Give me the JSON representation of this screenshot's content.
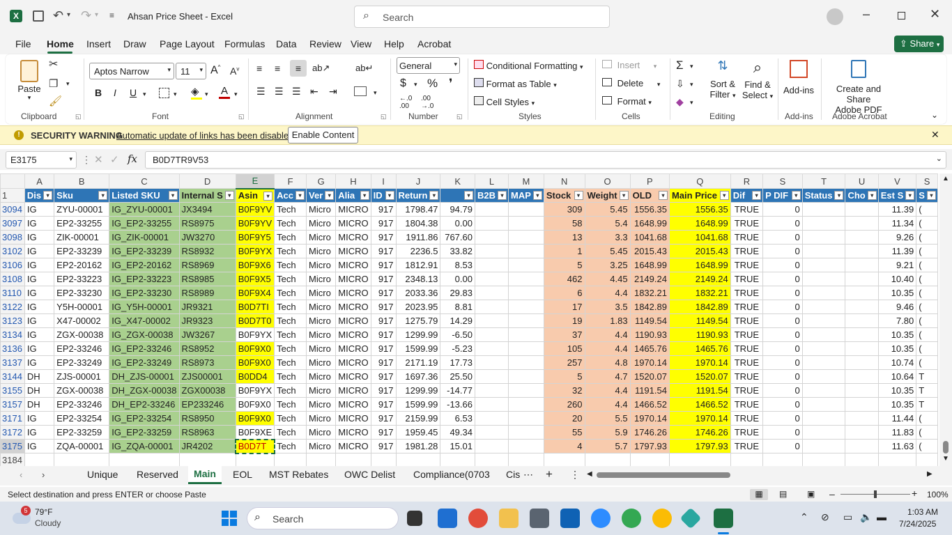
{
  "app": {
    "title": "Ahsan Price Sheet",
    "app_name": "Excel",
    "search_placeholder": "Search"
  },
  "ribbon_tabs": [
    "File",
    "Home",
    "Insert",
    "Draw",
    "Page Layout",
    "Formulas",
    "Data",
    "Review",
    "View",
    "Help",
    "Acrobat"
  ],
  "share_label": "Share",
  "ribbon": {
    "paste": "Paste",
    "font_name": "Aptos Narrow",
    "font_size": "11",
    "number_format": "General",
    "conditional_formatting": "Conditional Formatting",
    "format_as_table": "Format as Table",
    "cell_styles": "Cell Styles",
    "insert": "Insert",
    "delete": "Delete",
    "format": "Format",
    "sort_filter_1": "Sort &",
    "sort_filter_2": "Filter",
    "find_select_1": "Find &",
    "find_select_2": "Select",
    "add_ins": "Add-ins",
    "create_share_1": "Create and Share",
    "create_share_2": "Adobe PDF",
    "groups": {
      "clipboard": "Clipboard",
      "font": "Font",
      "alignment": "Alignment",
      "number": "Number",
      "styles": "Styles",
      "cells": "Cells",
      "editing": "Editing",
      "addins": "Add-ins",
      "acrobat": "Adobe Acrobat"
    }
  },
  "security": {
    "title": "SECURITY WARNING",
    "message": "Automatic update of links has been disabled",
    "button": "Enable Content"
  },
  "formula_bar": {
    "name_box": "E3175",
    "fx": "fx",
    "value": "B0D7TR9V53"
  },
  "columns": [
    {
      "letter": "A",
      "width": 38
    },
    {
      "letter": "B",
      "width": 101
    },
    {
      "letter": "C",
      "width": 94
    },
    {
      "letter": "D",
      "width": 79
    },
    {
      "letter": "E",
      "width": 44
    },
    {
      "letter": "F",
      "width": 38
    },
    {
      "letter": "G",
      "width": 40
    },
    {
      "letter": "H",
      "width": 40
    },
    {
      "letter": "I",
      "width": 40
    },
    {
      "letter": "J",
      "width": 62
    },
    {
      "letter": "K",
      "width": 62
    },
    {
      "letter": "L",
      "width": 48
    },
    {
      "letter": "M",
      "width": 49
    },
    {
      "letter": "N",
      "width": 64
    },
    {
      "letter": "O",
      "width": 64
    },
    {
      "letter": "P",
      "width": 67
    },
    {
      "letter": "Q",
      "width": 91
    },
    {
      "letter": "R",
      "width": 64
    },
    {
      "letter": "S",
      "width": 64
    },
    {
      "letter": "T",
      "width": 55
    },
    {
      "letter": "U",
      "width": 42
    },
    {
      "letter": "V",
      "width": 54
    },
    {
      "letter": "S",
      "width": 20
    }
  ],
  "header_row": {
    "num": "1",
    "cells": [
      "Dis",
      "Sku",
      "Listed SKU",
      "Internal S",
      "Asin",
      "Acc",
      "Ver",
      "Alia",
      "ID",
      "Return",
      "",
      "B2B",
      "MAP",
      "Stock",
      "Weight",
      "OLD",
      "Main Price",
      "Dif",
      "P DIF",
      "Status",
      "Cho",
      "Est S",
      "S"
    ]
  },
  "rows": [
    {
      "num": "3094",
      "cells": [
        "IG",
        "ZYU-00001",
        "IG_ZYU-00001",
        "JX3494",
        "B0F9YV",
        "Tech",
        "Micro",
        "MICRO",
        "917",
        "1798.47",
        "94.79",
        "",
        "",
        "309",
        "5.45",
        "1556.35",
        "1556.35",
        "TRUE",
        "0",
        "",
        "",
        "11.39",
        "("
      ]
    },
    {
      "num": "3097",
      "cells": [
        "IG",
        "EP2-33255",
        "IG_EP2-33255",
        "RS8975",
        "B0F9YV",
        "Tech",
        "Micro",
        "MICRO",
        "917",
        "1804.38",
        "0.00",
        "",
        "",
        "58",
        "5.4",
        "1648.99",
        "1648.99",
        "TRUE",
        "0",
        "",
        "",
        "11.34",
        "("
      ]
    },
    {
      "num": "3098",
      "cells": [
        "IG",
        "ZIK-00001",
        "IG_ZIK-00001",
        "JW3270",
        "B0F9Y5",
        "Tech",
        "Micro",
        "MICRO",
        "917",
        "1911.86",
        "767.60",
        "",
        "",
        "13",
        "3.3",
        "1041.68",
        "1041.68",
        "TRUE",
        "0",
        "",
        "",
        "9.26",
        "("
      ]
    },
    {
      "num": "3102",
      "cells": [
        "IG",
        "EP2-33239",
        "IG_EP2-33239",
        "RS8932",
        "B0F9YX",
        "Tech",
        "Micro",
        "MICRO",
        "917",
        "2236.5",
        "33.82",
        "",
        "",
        "1",
        "5.45",
        "2015.43",
        "2015.43",
        "TRUE",
        "0",
        "",
        "",
        "11.39",
        "("
      ]
    },
    {
      "num": "3106",
      "cells": [
        "IG",
        "EP2-20162",
        "IG_EP2-20162",
        "RS8969",
        "B0F9X6",
        "Tech",
        "Micro",
        "MICRO",
        "917",
        "1812.91",
        "8.53",
        "",
        "",
        "5",
        "3.25",
        "1648.99",
        "1648.99",
        "TRUE",
        "0",
        "",
        "",
        "9.21",
        "("
      ]
    },
    {
      "num": "3108",
      "cells": [
        "IG",
        "EP2-33223",
        "IG_EP2-33223",
        "RS8985",
        "B0F9X5",
        "Tech",
        "Micro",
        "MICRO",
        "917",
        "2348.13",
        "0.00",
        "",
        "",
        "462",
        "4.45",
        "2149.24",
        "2149.24",
        "TRUE",
        "0",
        "",
        "",
        "10.40",
        "("
      ]
    },
    {
      "num": "3110",
      "cells": [
        "IG",
        "EP2-33230",
        "IG_EP2-33230",
        "RS8989",
        "B0F9X4",
        "Tech",
        "Micro",
        "MICRO",
        "917",
        "2033.36",
        "29.83",
        "",
        "",
        "6",
        "4.4",
        "1832.21",
        "1832.21",
        "TRUE",
        "0",
        "",
        "",
        "10.35",
        "("
      ]
    },
    {
      "num": "3122",
      "cells": [
        "IG",
        "Y5H-00001",
        "IG_Y5H-00001",
        "JR9321",
        "B0D7TI",
        "Tech",
        "Micro",
        "MICRO",
        "917",
        "2023.95",
        "8.81",
        "",
        "",
        "17",
        "3.5",
        "1842.89",
        "1842.89",
        "TRUE",
        "0",
        "",
        "",
        "9.46",
        "("
      ]
    },
    {
      "num": "3123",
      "cells": [
        "IG",
        "X47-00002",
        "IG_X47-00002",
        "JR9323",
        "B0D7T0",
        "Tech",
        "Micro",
        "MICRO",
        "917",
        "1275.79",
        "14.29",
        "",
        "",
        "19",
        "1.83",
        "1149.54",
        "1149.54",
        "TRUE",
        "0",
        "",
        "",
        "7.80",
        "("
      ]
    },
    {
      "num": "3134",
      "cells": [
        "IG",
        "ZGX-00038",
        "IG_ZGX-00038",
        "JW3267",
        "B0F9YX",
        "Tech",
        "Micro",
        "MICRO",
        "917",
        "1299.99",
        "-6.50",
        "",
        "",
        "37",
        "4.4",
        "1190.93",
        "1190.93",
        "TRUE",
        "0",
        "",
        "",
        "10.35",
        "("
      ]
    },
    {
      "num": "3136",
      "cells": [
        "IG",
        "EP2-33246",
        "IG_EP2-33246",
        "RS8952",
        "B0F9X0",
        "Tech",
        "Micro",
        "MICRO",
        "917",
        "1599.99",
        "-5.23",
        "",
        "",
        "105",
        "4.4",
        "1465.76",
        "1465.76",
        "TRUE",
        "0",
        "",
        "",
        "10.35",
        "("
      ]
    },
    {
      "num": "3137",
      "cells": [
        "IG",
        "EP2-33249",
        "IG_EP2-33249",
        "RS8973",
        "B0F9X0",
        "Tech",
        "Micro",
        "MICRO",
        "917",
        "2171.19",
        "17.73",
        "",
        "",
        "257",
        "4.8",
        "1970.14",
        "1970.14",
        "TRUE",
        "0",
        "",
        "",
        "10.74",
        "("
      ]
    },
    {
      "num": "3144",
      "cells": [
        "DH",
        "ZJS-00001",
        "DH_ZJS-00001",
        "ZJS00001",
        "B0DD4",
        "Tech",
        "Micro",
        "MICRO",
        "917",
        "1697.36",
        "25.50",
        "",
        "",
        "5",
        "4.7",
        "1520.07",
        "1520.07",
        "TRUE",
        "0",
        "",
        "",
        "10.64",
        "T"
      ]
    },
    {
      "num": "3155",
      "cells": [
        "DH",
        "ZGX-00038",
        "DH_ZGX-00038",
        "ZGX00038",
        "B0F9YX",
        "Tech",
        "Micro",
        "MICRO",
        "917",
        "1299.99",
        "-14.77",
        "",
        "",
        "32",
        "4.4",
        "1191.54",
        "1191.54",
        "TRUE",
        "0",
        "",
        "",
        "10.35",
        "T"
      ]
    },
    {
      "num": "3157",
      "cells": [
        "DH",
        "EP2-33246",
        "DH_EP2-33246",
        "EP233246",
        "B0F9X0",
        "Tech",
        "Micro",
        "MICRO",
        "917",
        "1599.99",
        "-13.66",
        "",
        "",
        "260",
        "4.4",
        "1466.52",
        "1466.52",
        "TRUE",
        "0",
        "",
        "",
        "10.35",
        "T"
      ]
    },
    {
      "num": "3171",
      "cells": [
        "IG",
        "EP2-33254",
        "IG_EP2-33254",
        "RS8950",
        "B0F9X0",
        "Tech",
        "Micro",
        "MICRO",
        "917",
        "2159.99",
        "6.53",
        "",
        "",
        "20",
        "5.5",
        "1970.14",
        "1970.14",
        "TRUE",
        "0",
        "",
        "",
        "11.44",
        "("
      ]
    },
    {
      "num": "3172",
      "cells": [
        "IG",
        "EP2-33259",
        "IG_EP2-33259",
        "RS8963",
        "B0F9XE",
        "Tech",
        "Micro",
        "MICRO",
        "917",
        "1959.45",
        "49.34",
        "",
        "",
        "55",
        "5.9",
        "1746.26",
        "1746.26",
        "TRUE",
        "0",
        "",
        "",
        "11.83",
        "("
      ]
    },
    {
      "num": "3175",
      "cells": [
        "IG",
        "ZQA-00001",
        "IG_ZQA-00001",
        "JR4202",
        "B0D7T",
        "Tech",
        "Micro",
        "MICRO",
        "917",
        "1981.28",
        "15.01",
        "",
        "",
        "4",
        "5.7",
        "1797.93",
        "1797.93",
        "TRUE",
        "0",
        "",
        "",
        "11.63",
        "("
      ]
    }
  ],
  "empty_row": "3184",
  "sheet_tabs": [
    "Unique",
    "Reserved",
    "Main",
    "EOL",
    "MST Rebates",
    "OWC Delist",
    "Compliance(0703",
    "Cis"
  ],
  "active_sheet": "Main",
  "status": {
    "message": "Select destination and press ENTER or choose Paste",
    "zoom": "100%"
  },
  "taskbar": {
    "weather_temp": "79°F",
    "weather_desc": "Cloudy",
    "weather_badge": "5",
    "search": "Search",
    "time": "1:03 AM",
    "date": "7/24/2025"
  }
}
